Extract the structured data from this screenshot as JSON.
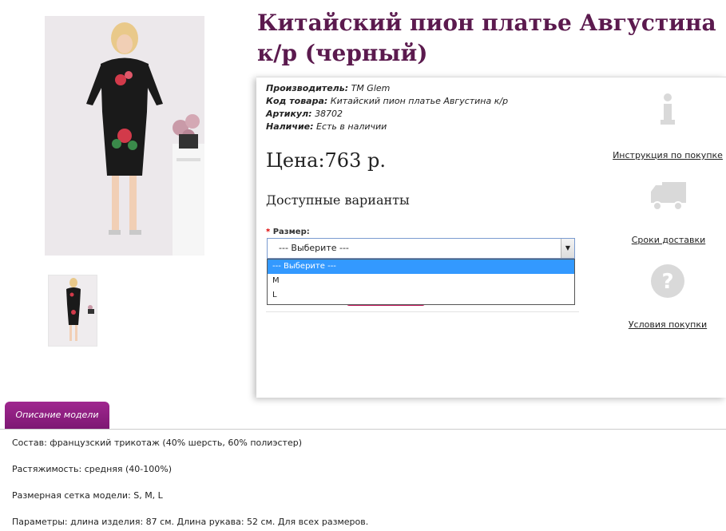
{
  "product": {
    "title": "Китайский пион платье Августина к/р (черный)",
    "manufacturer_label": "Производитель:",
    "manufacturer": "TM Glem",
    "code_label": "Код товара:",
    "code": "Китайский пион платье Августина к/р",
    "article_label": "Артикул:",
    "article": "38702",
    "stock_label": "Наличие:",
    "stock": "Есть в наличии",
    "price": "Цена:763 р.",
    "variants_heading": "Доступные варианты"
  },
  "size_select": {
    "label": "Размер:",
    "required_mark": "*",
    "value": "--- Выберите ---",
    "options": [
      "--- Выберите ---",
      "M",
      "L"
    ]
  },
  "side_links": {
    "instruction": "Инструкция по покупке",
    "delivery": "Сроки доставки",
    "conditions": "Условия покупки"
  },
  "tabs": {
    "description": "Описание модели"
  },
  "description": {
    "composition_label": "Состав:",
    "composition": "французский трикотаж (40% шерсть, 60% полиэстер)",
    "stretch_label": "Растяжимость:",
    "stretch": "средняя (40-100%)",
    "sizes_label": "Размерная сетка модели:",
    "sizes": "S, M, L",
    "params_label": "Параметры:",
    "params": "длина изделия: 87 см. Длина рукава: 52 см. Для всех размеров."
  },
  "colors": {
    "accent": "#7d1873",
    "title": "#5b1a4e",
    "selected_option": "#3399ff"
  }
}
